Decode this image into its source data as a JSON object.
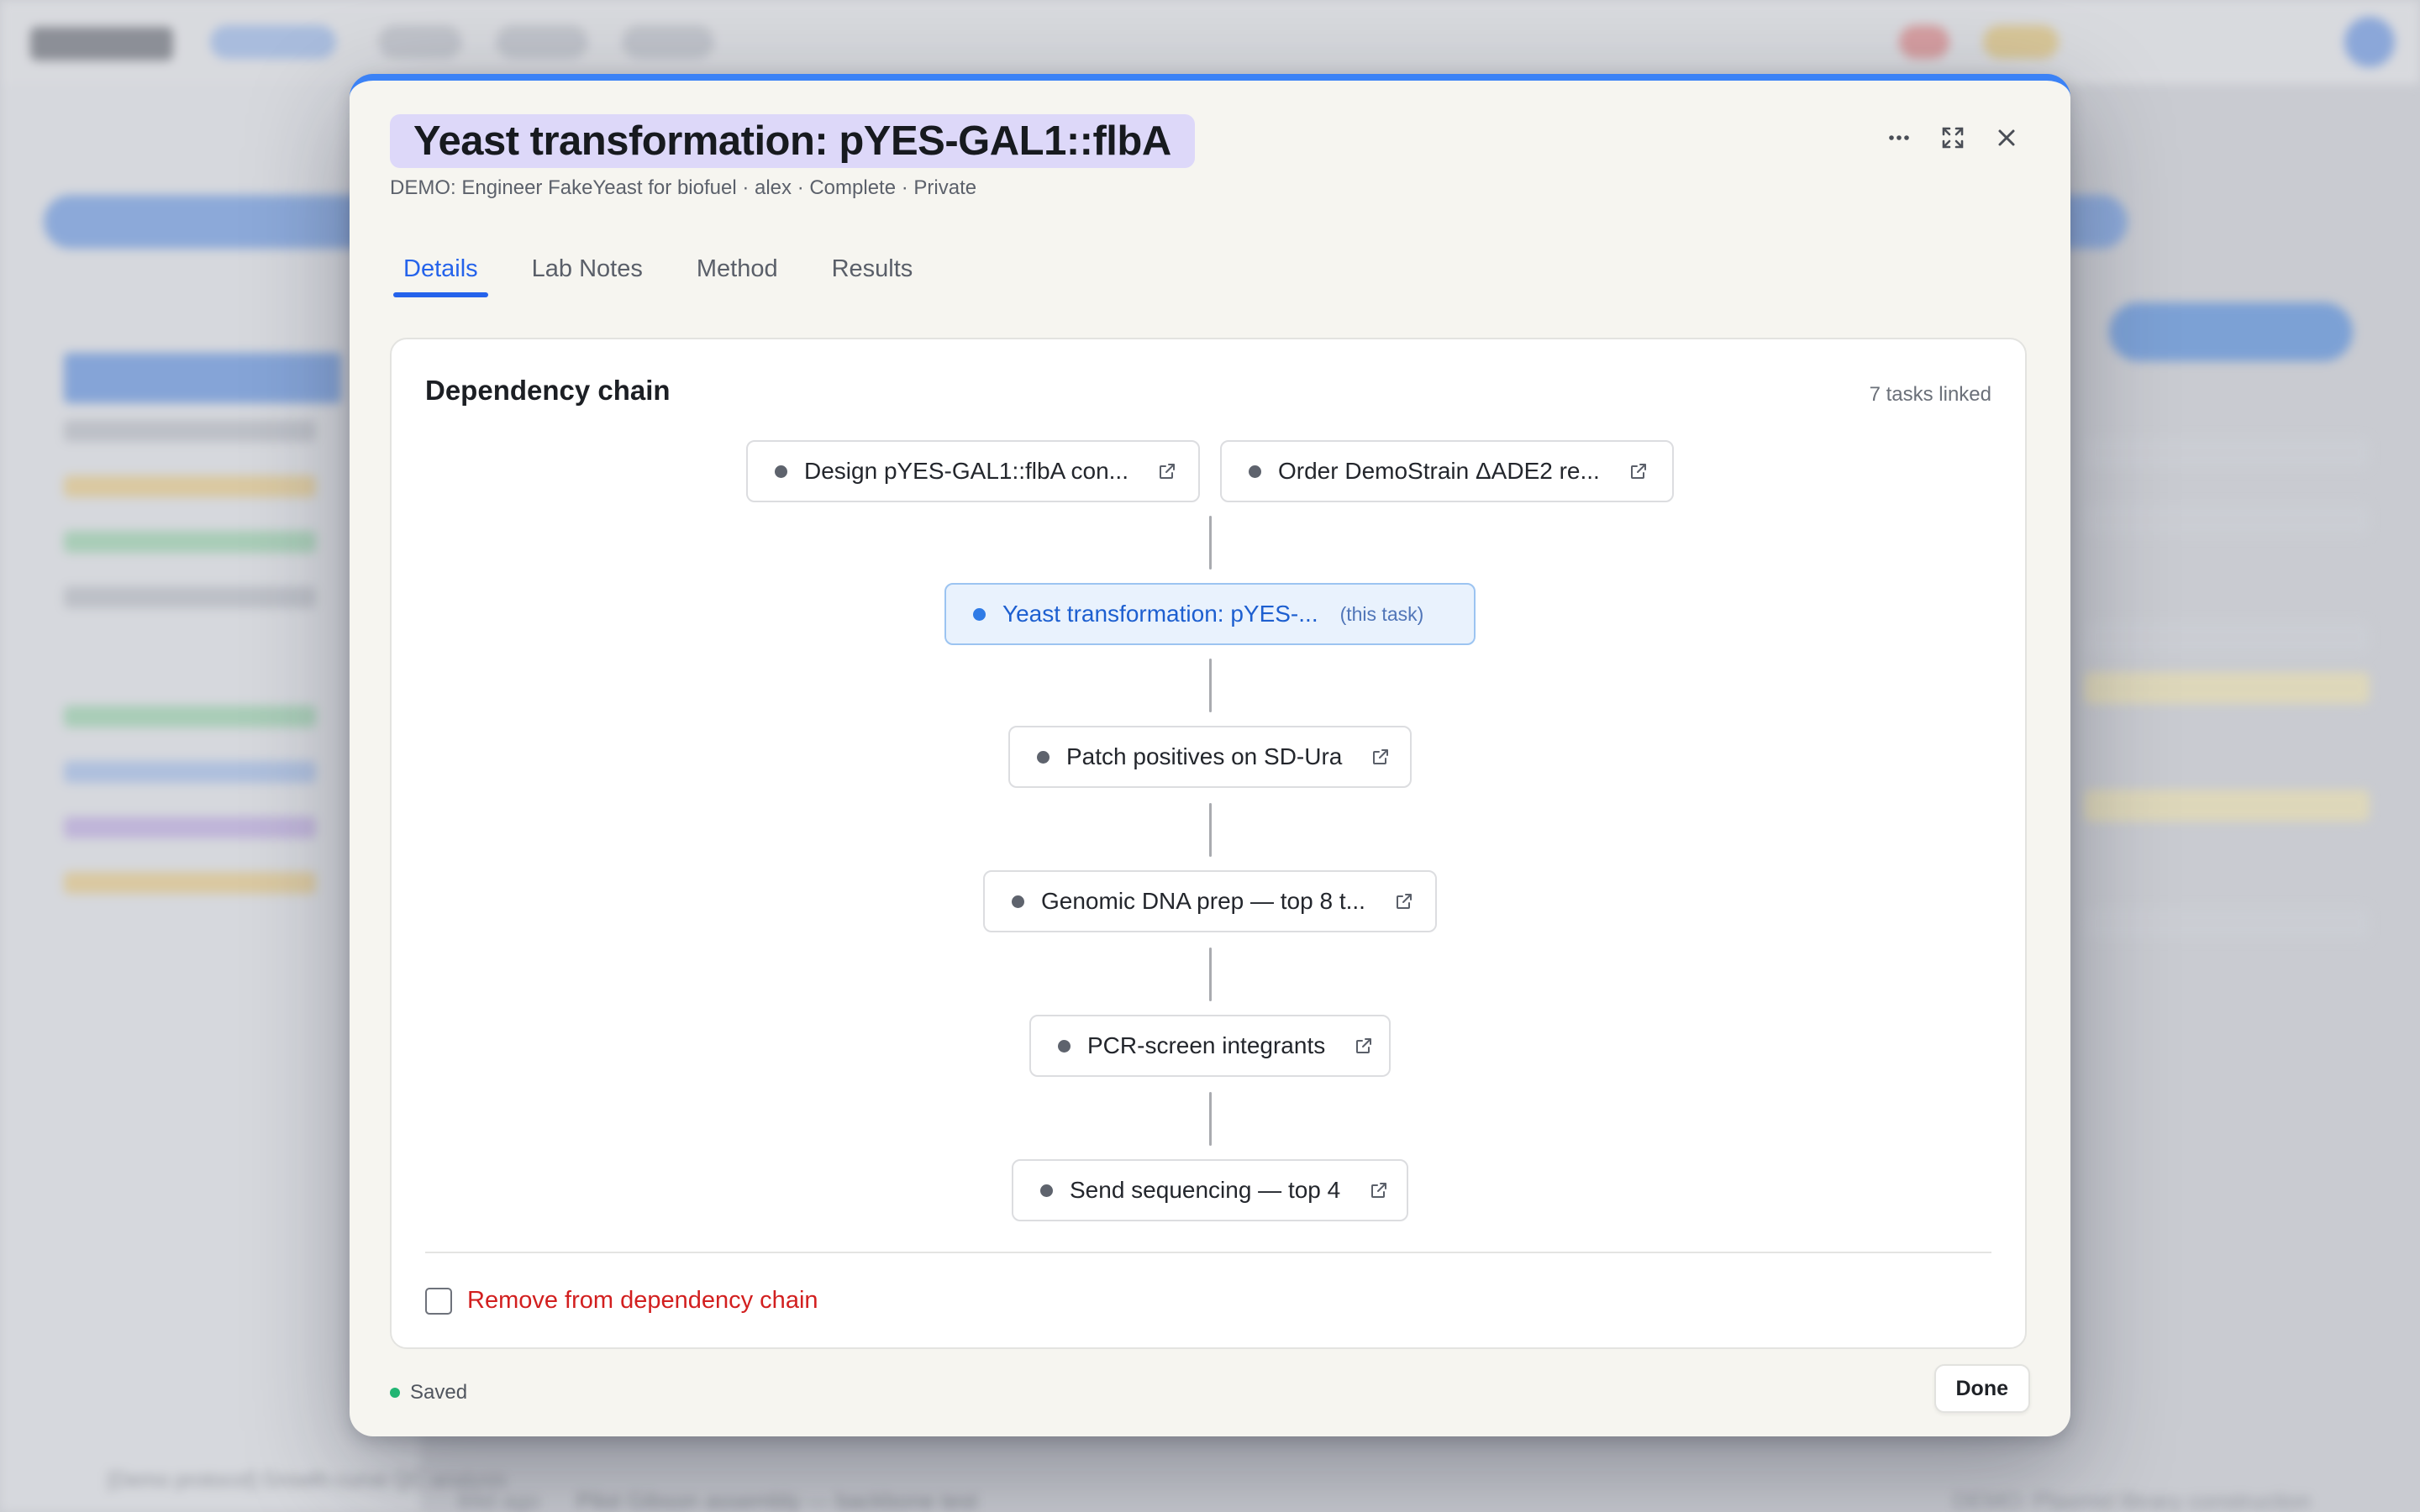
{
  "modal": {
    "title": "Yeast transformation: pYES-GAL1::flbA",
    "subtitle": "DEMO: Engineer FakeYeast for biofuel · alex · Complete · Private",
    "icons": [
      "more-horizontal-icon",
      "expand-icon",
      "close-icon"
    ],
    "accent_color": "#3b82f6",
    "tabs": [
      {
        "label": "Details",
        "active": true
      },
      {
        "label": "Lab Notes",
        "active": false
      },
      {
        "label": "Method",
        "active": false
      },
      {
        "label": "Results",
        "active": false
      }
    ]
  },
  "dependency_chain": {
    "title": "Dependency chain",
    "count_label": "7 tasks linked",
    "nodes": [
      {
        "label": "Design pYES-GAL1::flbA con...",
        "icon": "external-link-icon"
      },
      {
        "label": "Order DemoStrain ΔADE2 re...",
        "icon": "external-link-icon"
      },
      {
        "label": "Yeast transformation: pYES-...",
        "tag": "(this task)",
        "current": true
      },
      {
        "label": "Patch positives on SD-Ura",
        "icon": "external-link-icon"
      },
      {
        "label": "Genomic DNA prep — top 8 t...",
        "icon": "external-link-icon"
      },
      {
        "label": "PCR-screen integrants",
        "icon": "external-link-icon"
      },
      {
        "label": "Send sequencing — top 4",
        "icon": "external-link-icon"
      }
    ],
    "remove_label": "Remove from dependency chain",
    "remove_checked": false
  },
  "footer": {
    "status": "Saved",
    "status_color": "#22b573",
    "done_label": "Done"
  },
  "background": {
    "row_text": "84d ago",
    "row_title": "Pilot Gibson assembly — backbone test",
    "row_project": "DEMO: Plasmid library construction",
    "side_text": "[Demo protocol] Growth-curve QC analysis"
  }
}
